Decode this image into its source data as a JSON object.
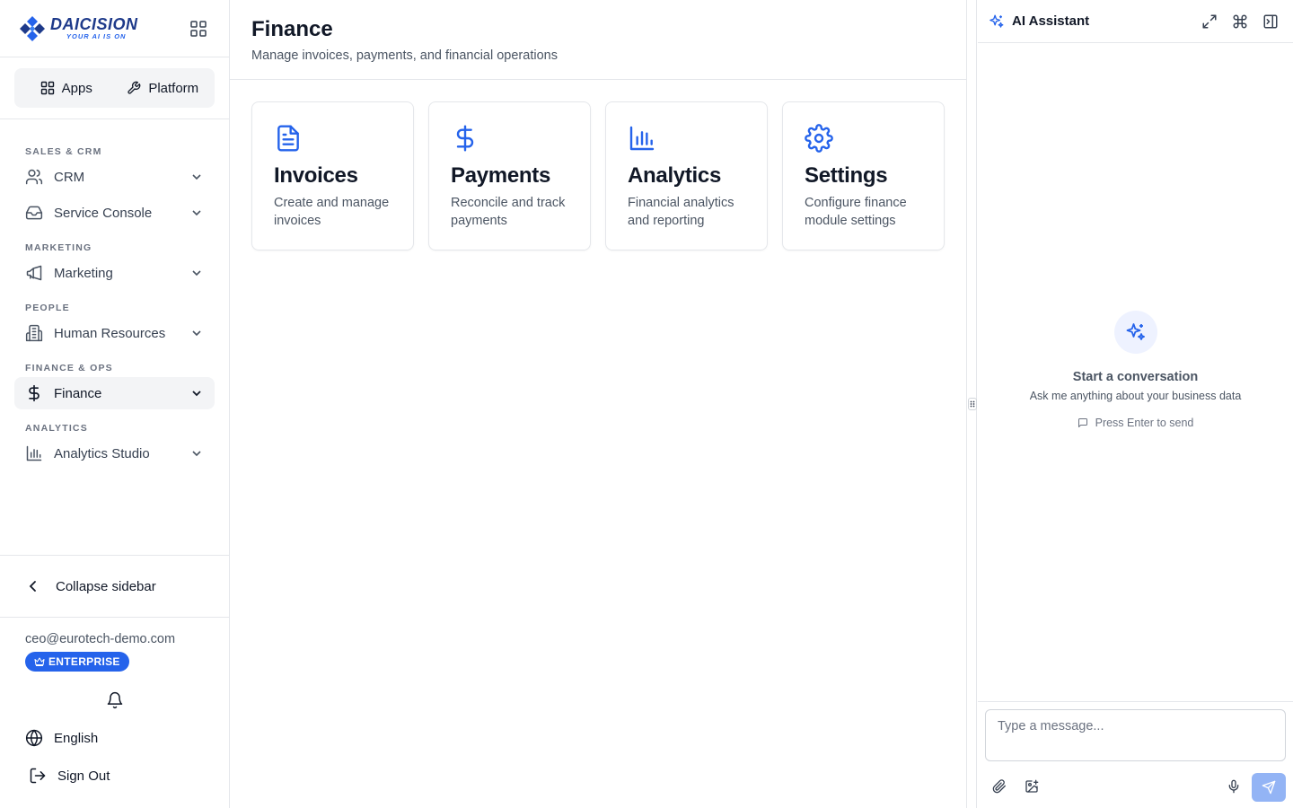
{
  "brand": {
    "name": "DAICISION",
    "tagline": "YOUR AI IS ON"
  },
  "switcher": {
    "apps": "Apps",
    "platform": "Platform"
  },
  "sidebar": {
    "sections": [
      {
        "label": "SALES & CRM",
        "items": [
          {
            "label": "CRM",
            "icon": "users-icon"
          },
          {
            "label": "Service Console",
            "icon": "inbox-icon"
          }
        ]
      },
      {
        "label": "MARKETING",
        "items": [
          {
            "label": "Marketing",
            "icon": "megaphone-icon"
          }
        ]
      },
      {
        "label": "PEOPLE",
        "items": [
          {
            "label": "Human Resources",
            "icon": "building-icon"
          }
        ]
      },
      {
        "label": "FINANCE & OPS",
        "items": [
          {
            "label": "Finance",
            "icon": "dollar-icon",
            "active": true
          }
        ]
      },
      {
        "label": "ANALYTICS",
        "items": [
          {
            "label": "Analytics Studio",
            "icon": "bar-chart-icon"
          }
        ]
      }
    ],
    "collapse_label": "Collapse sidebar",
    "user_email": "ceo@eurotech-demo.com",
    "plan_badge": "ENTERPRISE",
    "language": "English",
    "sign_out": "Sign Out"
  },
  "main": {
    "title": "Finance",
    "subtitle": "Manage invoices, payments, and financial operations",
    "cards": [
      {
        "title": "Invoices",
        "description": "Create and manage invoices",
        "icon": "file-text-icon"
      },
      {
        "title": "Payments",
        "description": "Reconcile and track payments",
        "icon": "dollar-icon"
      },
      {
        "title": "Analytics",
        "description": "Financial analytics and reporting",
        "icon": "bar-chart-icon"
      },
      {
        "title": "Settings",
        "description": "Configure finance module settings",
        "icon": "gear-icon"
      }
    ]
  },
  "ai_panel": {
    "title": "AI Assistant",
    "empty_title": "Start a conversation",
    "empty_subtitle": "Ask me anything about your business data",
    "hint": "Press Enter to send",
    "input_placeholder": "Type a message..."
  },
  "colors": {
    "accent": "#2563eb",
    "send_disabled": "#93b4f5",
    "active_bg": "#f3f4f6"
  }
}
